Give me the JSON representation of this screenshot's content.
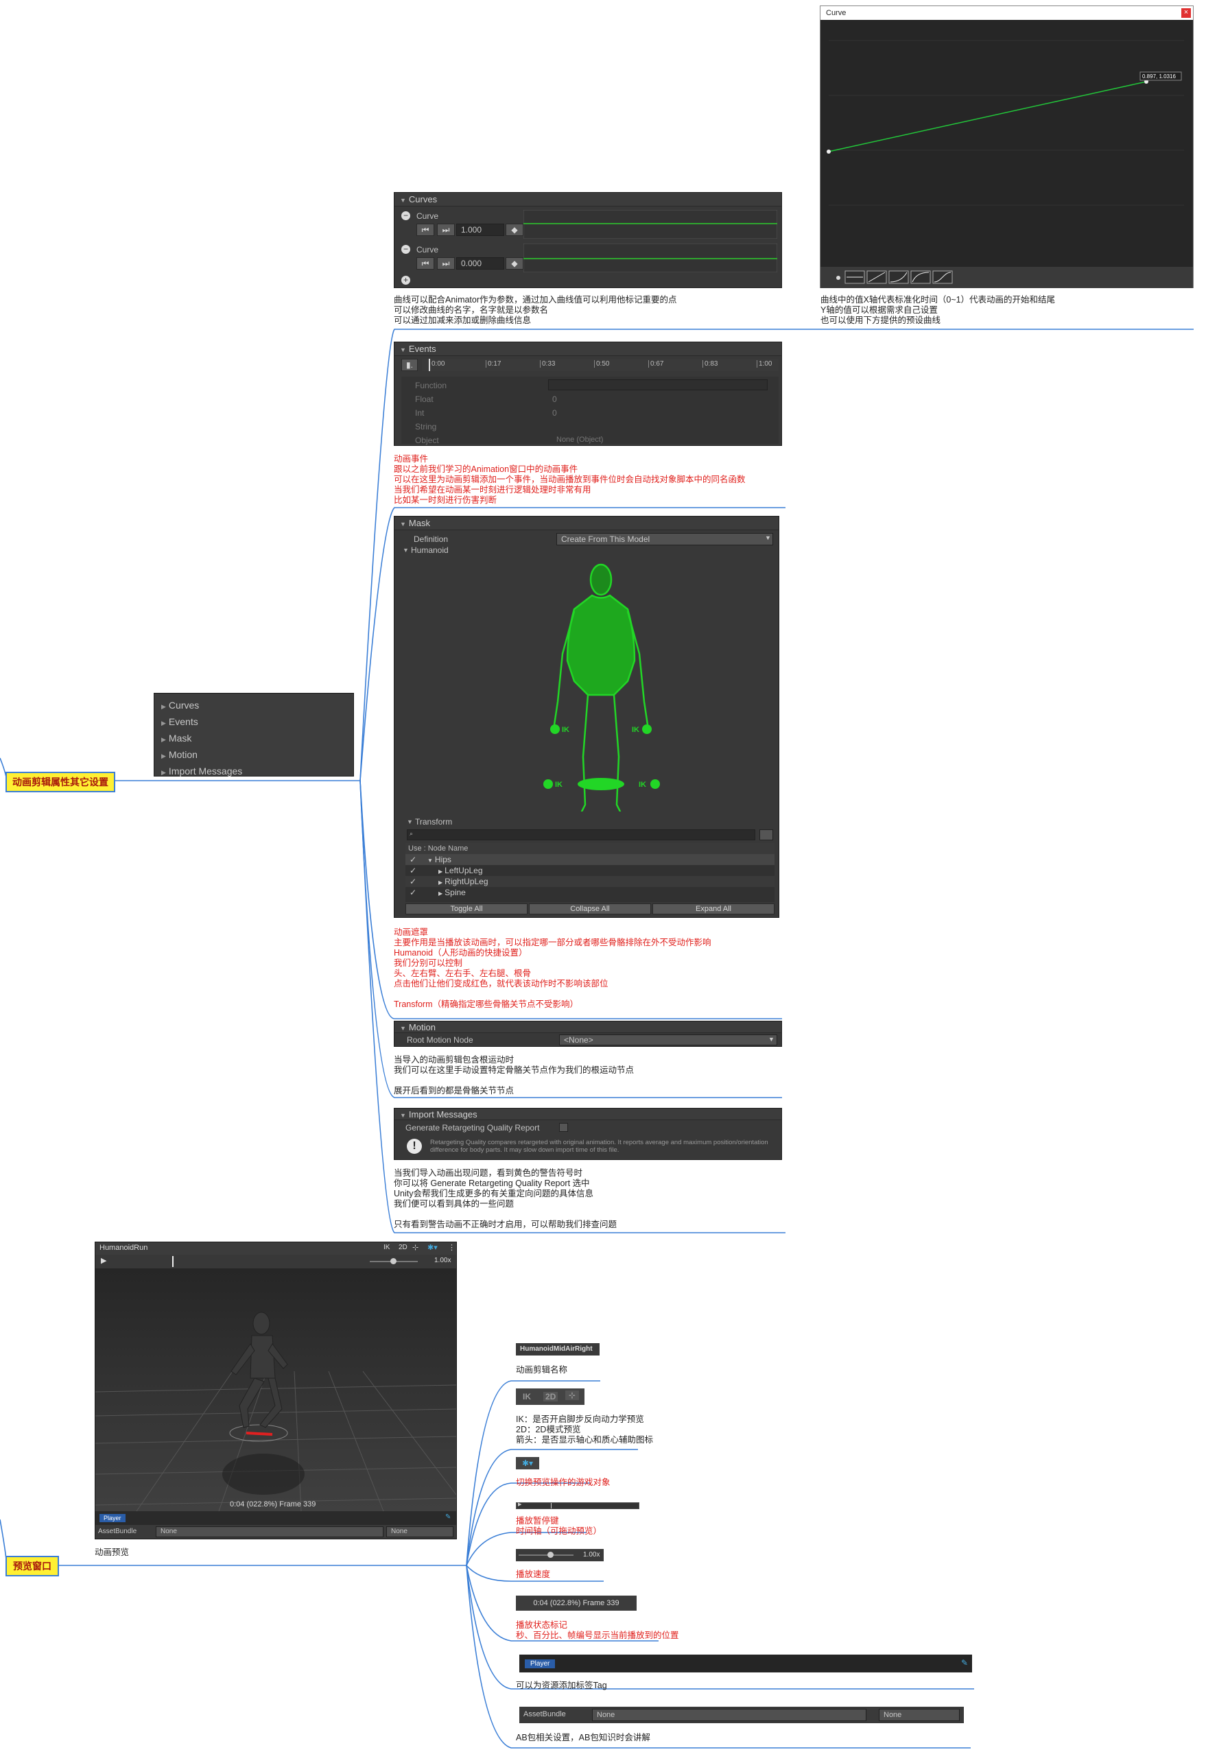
{
  "root_nodes": {
    "clip_settings": "动画剪辑属性其它设置",
    "preview_window": "预览窗口"
  },
  "foldout_menu": {
    "items": [
      "Curves",
      "Events",
      "Mask",
      "Motion",
      "Import Messages"
    ]
  },
  "curves_panel": {
    "header": "Curves",
    "curves": [
      {
        "label": "Curve",
        "value": "1.000"
      },
      {
        "label": "Curve",
        "value": "0.000"
      }
    ],
    "notes": [
      "曲线可以配合Animator作为参数，通过加入曲线值可以利用他标记重要的点",
      "可以修改曲线的名字，名字就是以参数名",
      "可以通过加减来添加或删除曲线信息"
    ]
  },
  "curve_window": {
    "title": "Curve",
    "close_glyph": "×",
    "point_label": "0.897, 1.0316",
    "notes": [
      "曲线中的值X轴代表标准化时间（0~1）代表动画的开始和结尾",
      "Y轴的值可以根据需求自己设置",
      "也可以使用下方提供的预设曲线"
    ]
  },
  "events_panel": {
    "header": "Events",
    "timeline_ticks": [
      "0:00",
      "0:17",
      "0:33",
      "0:50",
      "0:67",
      "0:83",
      "1:00"
    ],
    "fields": [
      {
        "label": "Function",
        "value": ""
      },
      {
        "label": "Float",
        "value": "0"
      },
      {
        "label": "Int",
        "value": "0"
      },
      {
        "label": "String",
        "value": ""
      },
      {
        "label": "Object",
        "value": "None (Object)"
      }
    ],
    "notes": [
      "动画事件",
      "跟以之前我们学习的Animation窗口中的动画事件",
      "可以在这里为动画剪辑添加一个事件，当动画播放到事件位时会自动找对象脚本中的同名函数",
      "当我们希望在动画某一时刻进行逻辑处理时非常有用",
      "比如某一时刻进行伤害判断"
    ]
  },
  "mask_panel": {
    "header": "Mask",
    "definition_label": "Definition",
    "definition_value": "Create From This Model",
    "humanoid_label": "Humanoid",
    "ik_label": "IK",
    "transform_label": "Transform",
    "search_placeholder": "",
    "table_header": "Use : Node Name",
    "nodes": [
      "Hips",
      "LeftUpLeg",
      "RightUpLeg",
      "Spine"
    ],
    "buttons": [
      "Toggle All",
      "Collapse All",
      "Expand All"
    ],
    "notes": [
      "动画遮罩",
      "主要作用是当播放该动画时，可以指定哪一部分或者哪些骨骼排除在外不受动作影响",
      "Humanoid（人形动画的快捷设置）",
      "我们分别可以控制",
      "头、左右臂、左右手、左右腿、根骨",
      "点击他们让他们变成红色，就代表该动作时不影响该部位",
      "",
      "Transform（精确指定哪些骨骼关节点不受影响）"
    ]
  },
  "motion_panel": {
    "header": "Motion",
    "root_label": "Root Motion Node",
    "root_value": "<None>",
    "notes": [
      "当导入的动画剪辑包含根运动时",
      "我们可以在这里手动设置特定骨骼关节点作为我们的根运动节点",
      "",
      "展开后看到的都是骨骼关节节点"
    ]
  },
  "import_panel": {
    "header": "Import Messages",
    "toggle_label": "Generate Retargeting Quality Report",
    "warning": "Retargeting Quality compares retargeted with original animation. It reports average and maximum position/orientation difference for body parts. It may slow down import time of this file.",
    "notes": [
      "当我们导入动画出现问题，看到黄色的警告符号时",
      "你可以将 Generate Retargeting Quality Report 选中",
      "Unity会帮我们生成更多的有关重定向问题的具体信息",
      "我们便可以看到具体的一些问题",
      "",
      "只有看到警告动画不正确时才启用，可以帮助我们排查问题"
    ]
  },
  "preview": {
    "clip_name": "HumanoidRun",
    "ik": "IK",
    "twod": "2D",
    "speed": "1.00x",
    "status": "0:04 (022.8%) Frame 339",
    "tag": "Player",
    "assetbundle_label": "AssetBundle",
    "assetbundle_value": "None",
    "variant_value": "None",
    "caption": "动画预览"
  },
  "preview_branches": [
    {
      "img": "HumanoidMidAirRight",
      "notes": [
        "动画剪辑名称"
      ],
      "color": "#222"
    },
    {
      "img": "IK 2D",
      "notes": [
        "IK：是否开启脚步反向动力学预览",
        "2D：2D模式预览",
        "箭头：是否显示轴心和质心辅助图标"
      ],
      "color": "#222"
    },
    {
      "img": "",
      "notes": [
        "切换预览操作的游戏对象"
      ],
      "color": "#e0201c"
    },
    {
      "img": "",
      "notes": [
        "播放暂停键",
        "时间轴（可拖动预览）"
      ],
      "color": "#e0201c"
    },
    {
      "img": "1.00x",
      "notes": [
        "播放速度"
      ],
      "color": "#e0201c"
    },
    {
      "img": "0:04 (022.8%) Frame 339",
      "notes": [
        "播放状态标记",
        "秒、百分比、帧编号显示当前播放到的位置"
      ],
      "color": "#e0201c"
    },
    {
      "img": "Player",
      "notes": [
        "可以为资源添加标签Tag"
      ],
      "color": "#222"
    },
    {
      "img": "AssetBundle",
      "notes": [
        "AB包相关设置，AB包知识时会讲解"
      ],
      "color": "#222"
    }
  ],
  "ab_row": {
    "label": "AssetBundle",
    "value": "None",
    "variant": "None"
  },
  "colors": {
    "accent": "#3a7ed6",
    "node_fill": "#fff033",
    "note_red": "#e0201c",
    "unity_bg": "#383838",
    "mask_green": "#22d626"
  }
}
